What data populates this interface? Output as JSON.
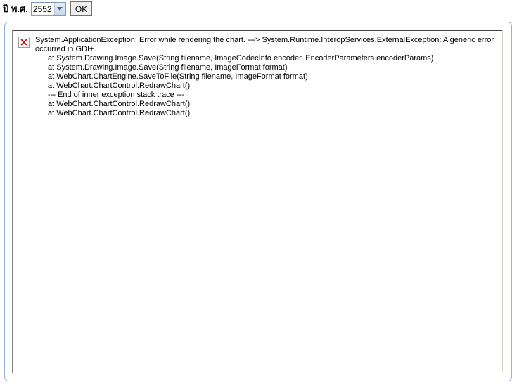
{
  "controls": {
    "year_label": "ปี พ.ศ.",
    "year_value": "2552",
    "ok_label": "OK"
  },
  "error": {
    "line1": "System.ApplicationException: Error while rendering the chart. ---> System.Runtime.InteropServices.ExternalException: A generic error",
    "line2": "occurred in GDI+.",
    "stack": [
      "at System.Drawing.Image.Save(String filename, ImageCodecInfo encoder, EncoderParameters encoderParams)",
      "at System.Drawing.Image.Save(String filename, ImageFormat format)",
      "at WebChart.ChartEngine.SaveToFile(String filename, ImageFormat format)",
      "at WebChart.ChartControl.RedrawChart()",
      "--- End of inner exception stack trace ---",
      "at WebChart.ChartControl.RedrawChart()",
      "at WebChart.ChartControl.RedrawChart()"
    ]
  }
}
